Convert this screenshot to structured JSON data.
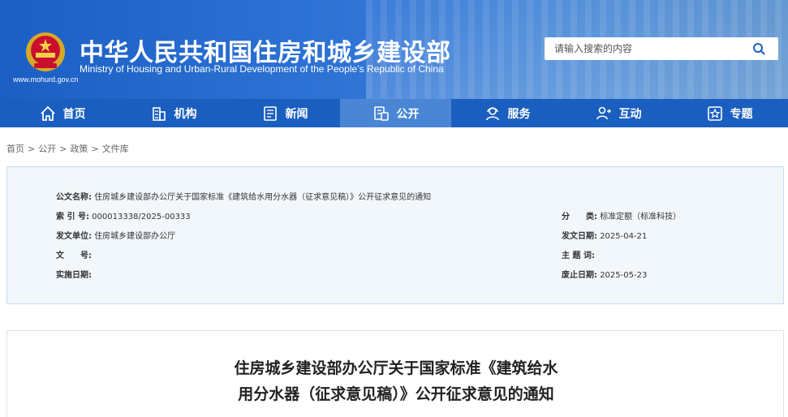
{
  "header": {
    "title": "中华人民共和国住房和城乡建设部",
    "subtitle": "Ministry of Housing and Urban-Rural Development of the People’s Republic of China",
    "url": "www.mohurd.gov.cn",
    "search_placeholder": "请输入搜索的内容",
    "brand_color": "#1a5fbf"
  },
  "nav": {
    "items": [
      {
        "label": "首页",
        "icon": "home-icon"
      },
      {
        "label": "机构",
        "icon": "building-icon"
      },
      {
        "label": "新闻",
        "icon": "news-icon"
      },
      {
        "label": "公开",
        "icon": "disclosure-icon",
        "active": true
      },
      {
        "label": "服务",
        "icon": "service-icon"
      },
      {
        "label": "互动",
        "icon": "interaction-icon"
      },
      {
        "label": "专题",
        "icon": "topic-star-icon"
      }
    ]
  },
  "breadcrumb": [
    "首页",
    "公开",
    "政策",
    "文件库"
  ],
  "meta": {
    "doc_name_label": "公文名称:",
    "doc_name": "住房城乡建设部办公厅关于国家标准《建筑给水用分水器（征求意见稿）》公开征求意见的通知",
    "index_label": "索 引 号:",
    "index": "000013338/2025-00333",
    "category_label": "分　　类:",
    "category": "标准定额（标准科技）",
    "issuer_label": "发文单位:",
    "issuer": "住房城乡建设部办公厅",
    "issue_date_label": "发文日期:",
    "issue_date": "2025-04-21",
    "doc_no_label": "文　　号:",
    "doc_no": "",
    "subject_label": "主 题 词:",
    "subject": "",
    "effective_label": "实施日期:",
    "effective": "",
    "deadline_label": "废止日期:",
    "deadline": "2025-05-23"
  },
  "article": {
    "title_line1": "住房城乡建设部办公厅关于国家标准《建筑给水",
    "title_line2": "用分水器（征求意见稿）》公开征求意见的通知"
  }
}
